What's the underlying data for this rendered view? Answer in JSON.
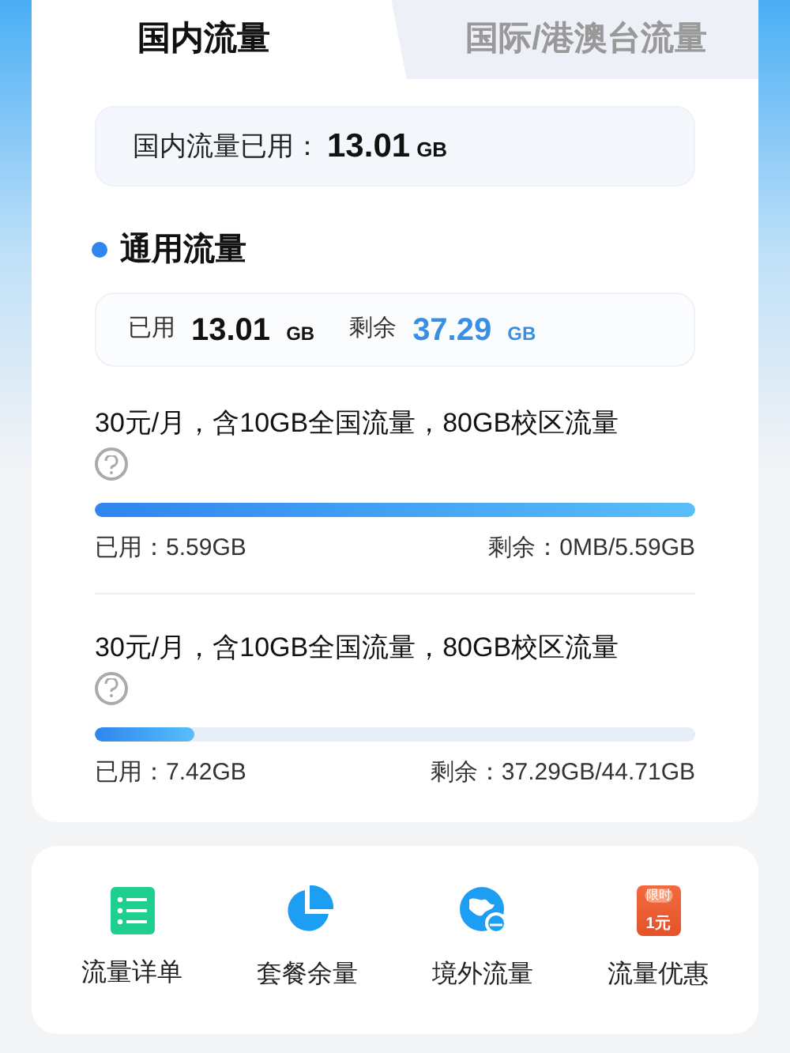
{
  "tabs": [
    {
      "label": "国内流量",
      "selected": true
    },
    {
      "label": "国际/港澳台流量",
      "selected": false
    }
  ],
  "summary": {
    "label": "国内流量已用：",
    "value": "13.01",
    "unit": "GB"
  },
  "section": {
    "title": "通用流量"
  },
  "stats": [
    {
      "label": "已用",
      "value": "13.01",
      "unit": "GB",
      "kind": "used"
    },
    {
      "label": "剩余",
      "value": "37.29",
      "unit": "GB",
      "kind": "remaining"
    }
  ],
  "plans": [
    {
      "title": "30元/月，含10GB全国流量，80GB校区流量",
      "level": 1,
      "used": "已用：5.59GB",
      "remaining": "剩余：0MB/5.59GB"
    },
    {
      "title": "30元/月，含10GB全国流量，80GB校区流量",
      "level": 0.166,
      "used": "已用：7.42GB",
      "remaining": "剩余：37.29GB/44.71GB"
    }
  ],
  "shortcuts": [
    {
      "label": "流量详单",
      "kind": "list"
    },
    {
      "label": "套餐余量",
      "kind": "pie"
    },
    {
      "label": "境外流量",
      "kind": "globe"
    },
    {
      "label": "流量优惠",
      "kind": "offer",
      "badge_top": "限时",
      "badge_bottom": "1元"
    }
  ]
}
